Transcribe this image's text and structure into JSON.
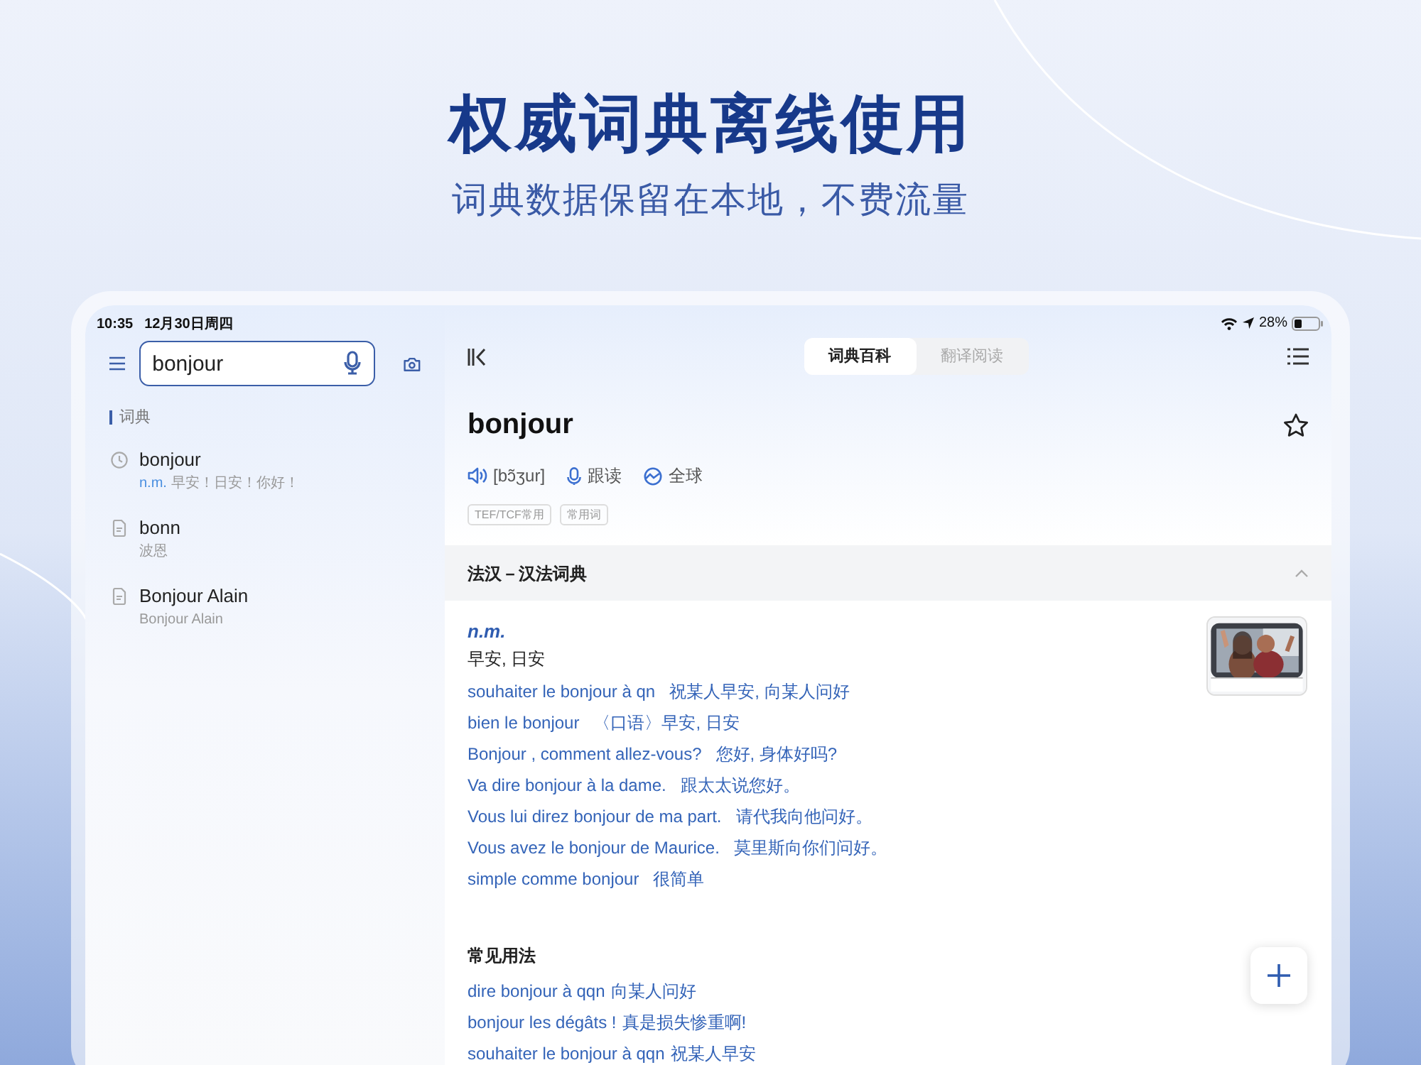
{
  "headline": "权威词典离线使用",
  "subheadline": "词典数据保留在本地，不费流量",
  "status_bar": {
    "time": "10:35",
    "date": "12月30日周四",
    "battery": "28%"
  },
  "search": {
    "value": "bonjour"
  },
  "sidebar": {
    "section_title": "词典",
    "items": [
      {
        "kind": "history",
        "word": "bonjour",
        "pos": "n.m.",
        "meaning": "早安！日安！你好！"
      },
      {
        "kind": "entry",
        "word": "bonn",
        "meaning": "波恩"
      },
      {
        "kind": "entry",
        "word": "Bonjour Alain",
        "meaning": "Bonjour Alain"
      }
    ]
  },
  "tabs": [
    {
      "label": "词典百科",
      "selected": true
    },
    {
      "label": "翻译阅读",
      "selected": false
    }
  ],
  "entry": {
    "word": "bonjour",
    "phonetic": "[bɔ̃ʒur]",
    "follow_read": "跟读",
    "region": "全球",
    "tags": [
      "TEF/TCF常用",
      "常用词"
    ],
    "dictionary": {
      "title": "法汉－汉法词典",
      "expanded": true
    },
    "pos": "n.m.",
    "definition": "早安, 日安",
    "examples": [
      {
        "fr": "souhaiter le bonjour à qn",
        "zh": "祝某人早安, 向某人问好"
      },
      {
        "fr": "bien le bonjour",
        "zh": "〈口语〉早安, 日安"
      },
      {
        "fr": "Bonjour , comment allez-vous?",
        "zh": "您好, 身体好吗?"
      },
      {
        "fr": "Va dire bonjour à la dame.",
        "zh": "跟太太说您好。"
      },
      {
        "fr": "Vous lui direz bonjour de ma part.",
        "zh": "请代我向他问好。"
      },
      {
        "fr": "Vous avez le bonjour de Maurice.",
        "zh": "莫里斯向你们问好。"
      },
      {
        "fr": "simple comme bonjour",
        "zh": "很简单"
      }
    ],
    "usage": {
      "title": "常见用法",
      "items": [
        {
          "fr": "dire bonjour à qqn",
          "zh": "向某人问好"
        },
        {
          "fr": "bonjour les dégâts !",
          "zh": "真是损失惨重啊!"
        },
        {
          "fr": "souhaiter le bonjour à qqn",
          "zh": "祝某人早安"
        }
      ]
    }
  }
}
